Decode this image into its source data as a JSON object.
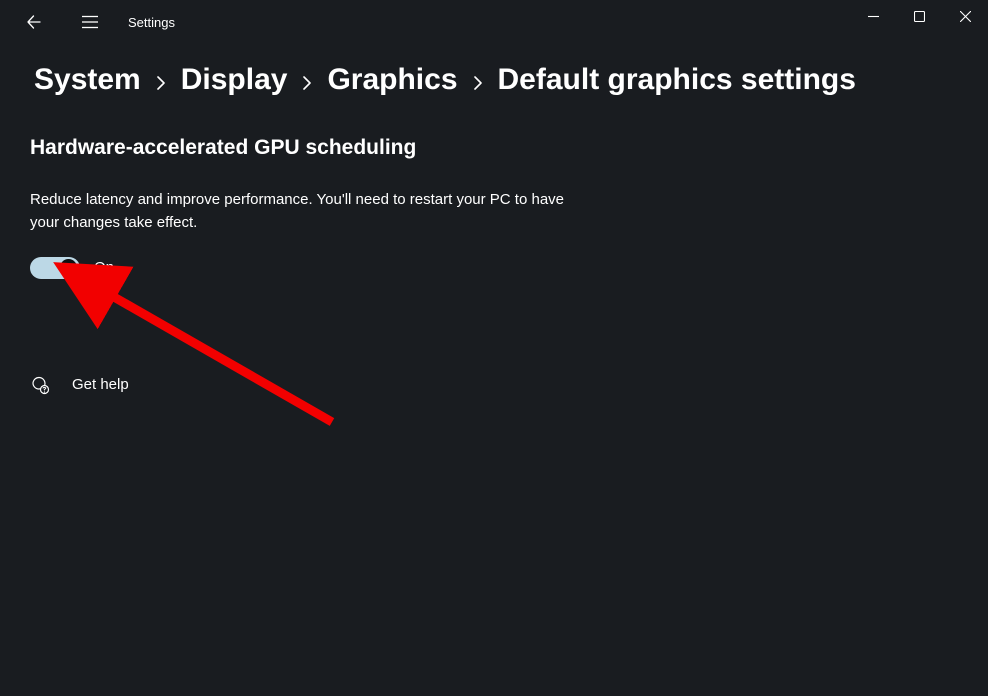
{
  "app": {
    "title": "Settings"
  },
  "breadcrumb": {
    "items": [
      "System",
      "Display",
      "Graphics",
      "Default graphics settings"
    ]
  },
  "section": {
    "title": "Hardware-accelerated GPU scheduling",
    "description": "Reduce latency and improve performance. You'll need to restart your PC to have your changes take effect.",
    "toggle_state": "On"
  },
  "help": {
    "label": "Get help"
  }
}
